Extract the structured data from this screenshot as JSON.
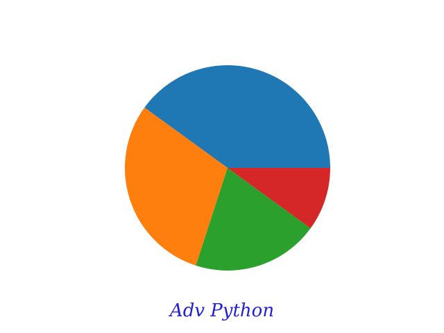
{
  "chart_data": {
    "type": "pie",
    "title": "",
    "xlabel": "Adv Python",
    "categories": [
      "",
      "",
      "",
      ""
    ],
    "values": [
      40,
      30,
      20,
      10
    ],
    "colors": [
      "#1f77b4",
      "#ff7f0e",
      "#2ca02c",
      "#d62728"
    ]
  }
}
